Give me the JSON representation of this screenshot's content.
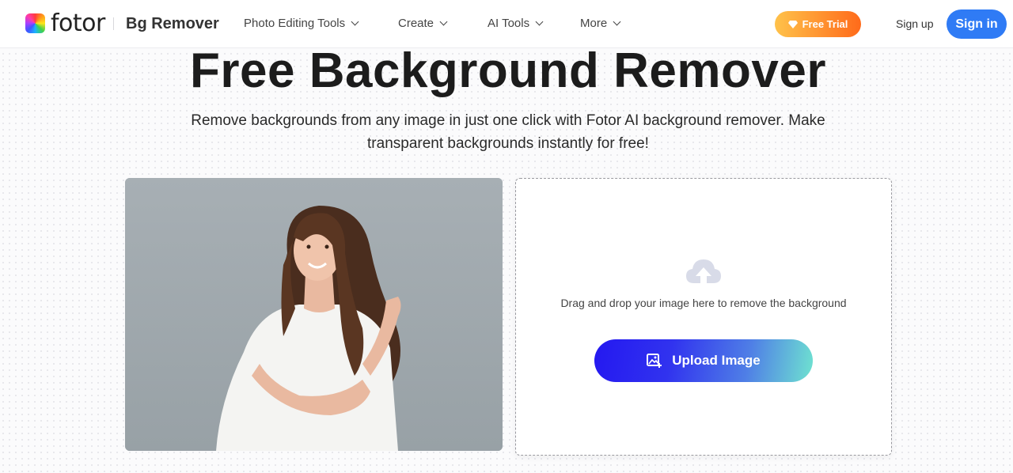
{
  "header": {
    "logo_text": "fotor",
    "product_name": "Bg Remover",
    "nav": [
      {
        "label": "Photo Editing Tools",
        "icon": "chevron-down-icon"
      },
      {
        "label": "Create",
        "icon": "chevron-down-icon"
      },
      {
        "label": "AI Tools",
        "icon": "chevron-down-icon"
      },
      {
        "label": "More",
        "icon": "chevron-down-icon"
      }
    ],
    "free_trial_label": "Free Trial",
    "sign_up_label": "Sign up",
    "sign_in_label": "Sign in"
  },
  "hero": {
    "title": "Free Background Remover",
    "subtitle": "Remove backgrounds from any image in just one click with Fotor AI background remover. Make transparent backgrounds instantly for free!"
  },
  "sample_image": {
    "alt": "Smiling woman with long wavy brown hair in white t-shirt"
  },
  "upload": {
    "drop_text": "Drag and drop your image here to remove the background",
    "button_label": "Upload Image"
  },
  "colors": {
    "sign_in": "#2f7bf5",
    "free_trial_start": "#ffc24a",
    "free_trial_end": "#ff6a1a",
    "upload_start": "#2418f0",
    "upload_end": "#6fe3d0"
  }
}
